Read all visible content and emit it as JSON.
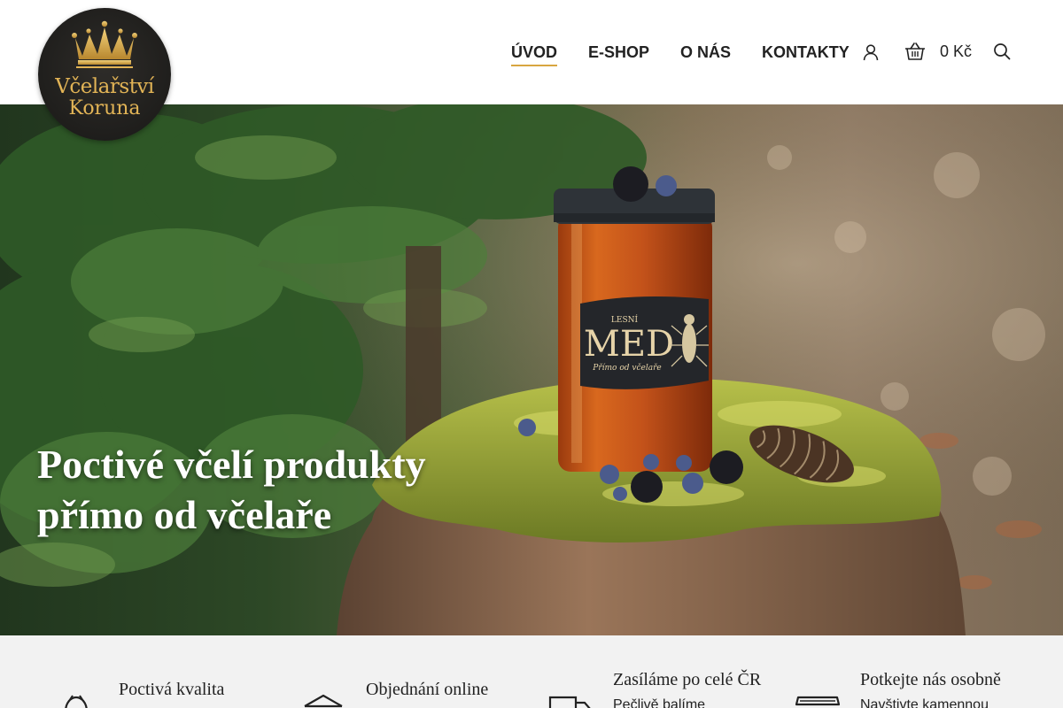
{
  "brand": {
    "logo_line1": "Včelařství",
    "logo_line2": "Koruna"
  },
  "nav": {
    "items": [
      {
        "label": "ÚVOD",
        "active": true
      },
      {
        "label": "E-SHOP",
        "active": false
      },
      {
        "label": "O NÁS",
        "active": false
      },
      {
        "label": "KONTAKTY",
        "active": false
      }
    ]
  },
  "header_actions": {
    "user_icon": "user-icon",
    "cart_icon": "basket-icon",
    "cart_value": "0 Kč",
    "search_icon": "search-icon"
  },
  "hero": {
    "title_line1": "Poctivé včelí produkty",
    "title_line2": "přímo od včelaře",
    "jar_label_top": "LESNÍ",
    "jar_label_main": "MED",
    "jar_label_script": "Přímo od včelaře"
  },
  "features": [
    {
      "icon": "bee-icon",
      "title": "Poctivá kvalita",
      "subtitle": ""
    },
    {
      "icon": "box-icon",
      "title": "Objednání online",
      "subtitle": ""
    },
    {
      "icon": "truck-icon",
      "title": "Zasíláme po celé ČR",
      "subtitle": "Pečlivě balíme"
    },
    {
      "icon": "shop-icon",
      "title": "Potkejte nás osobně",
      "subtitle": "Navštivte kamennou"
    }
  ],
  "colors": {
    "accent": "#d8a640",
    "logo_bg": "#1f1e1c",
    "logo_gold": "#e2b456",
    "features_bg": "#f2f2f2"
  }
}
